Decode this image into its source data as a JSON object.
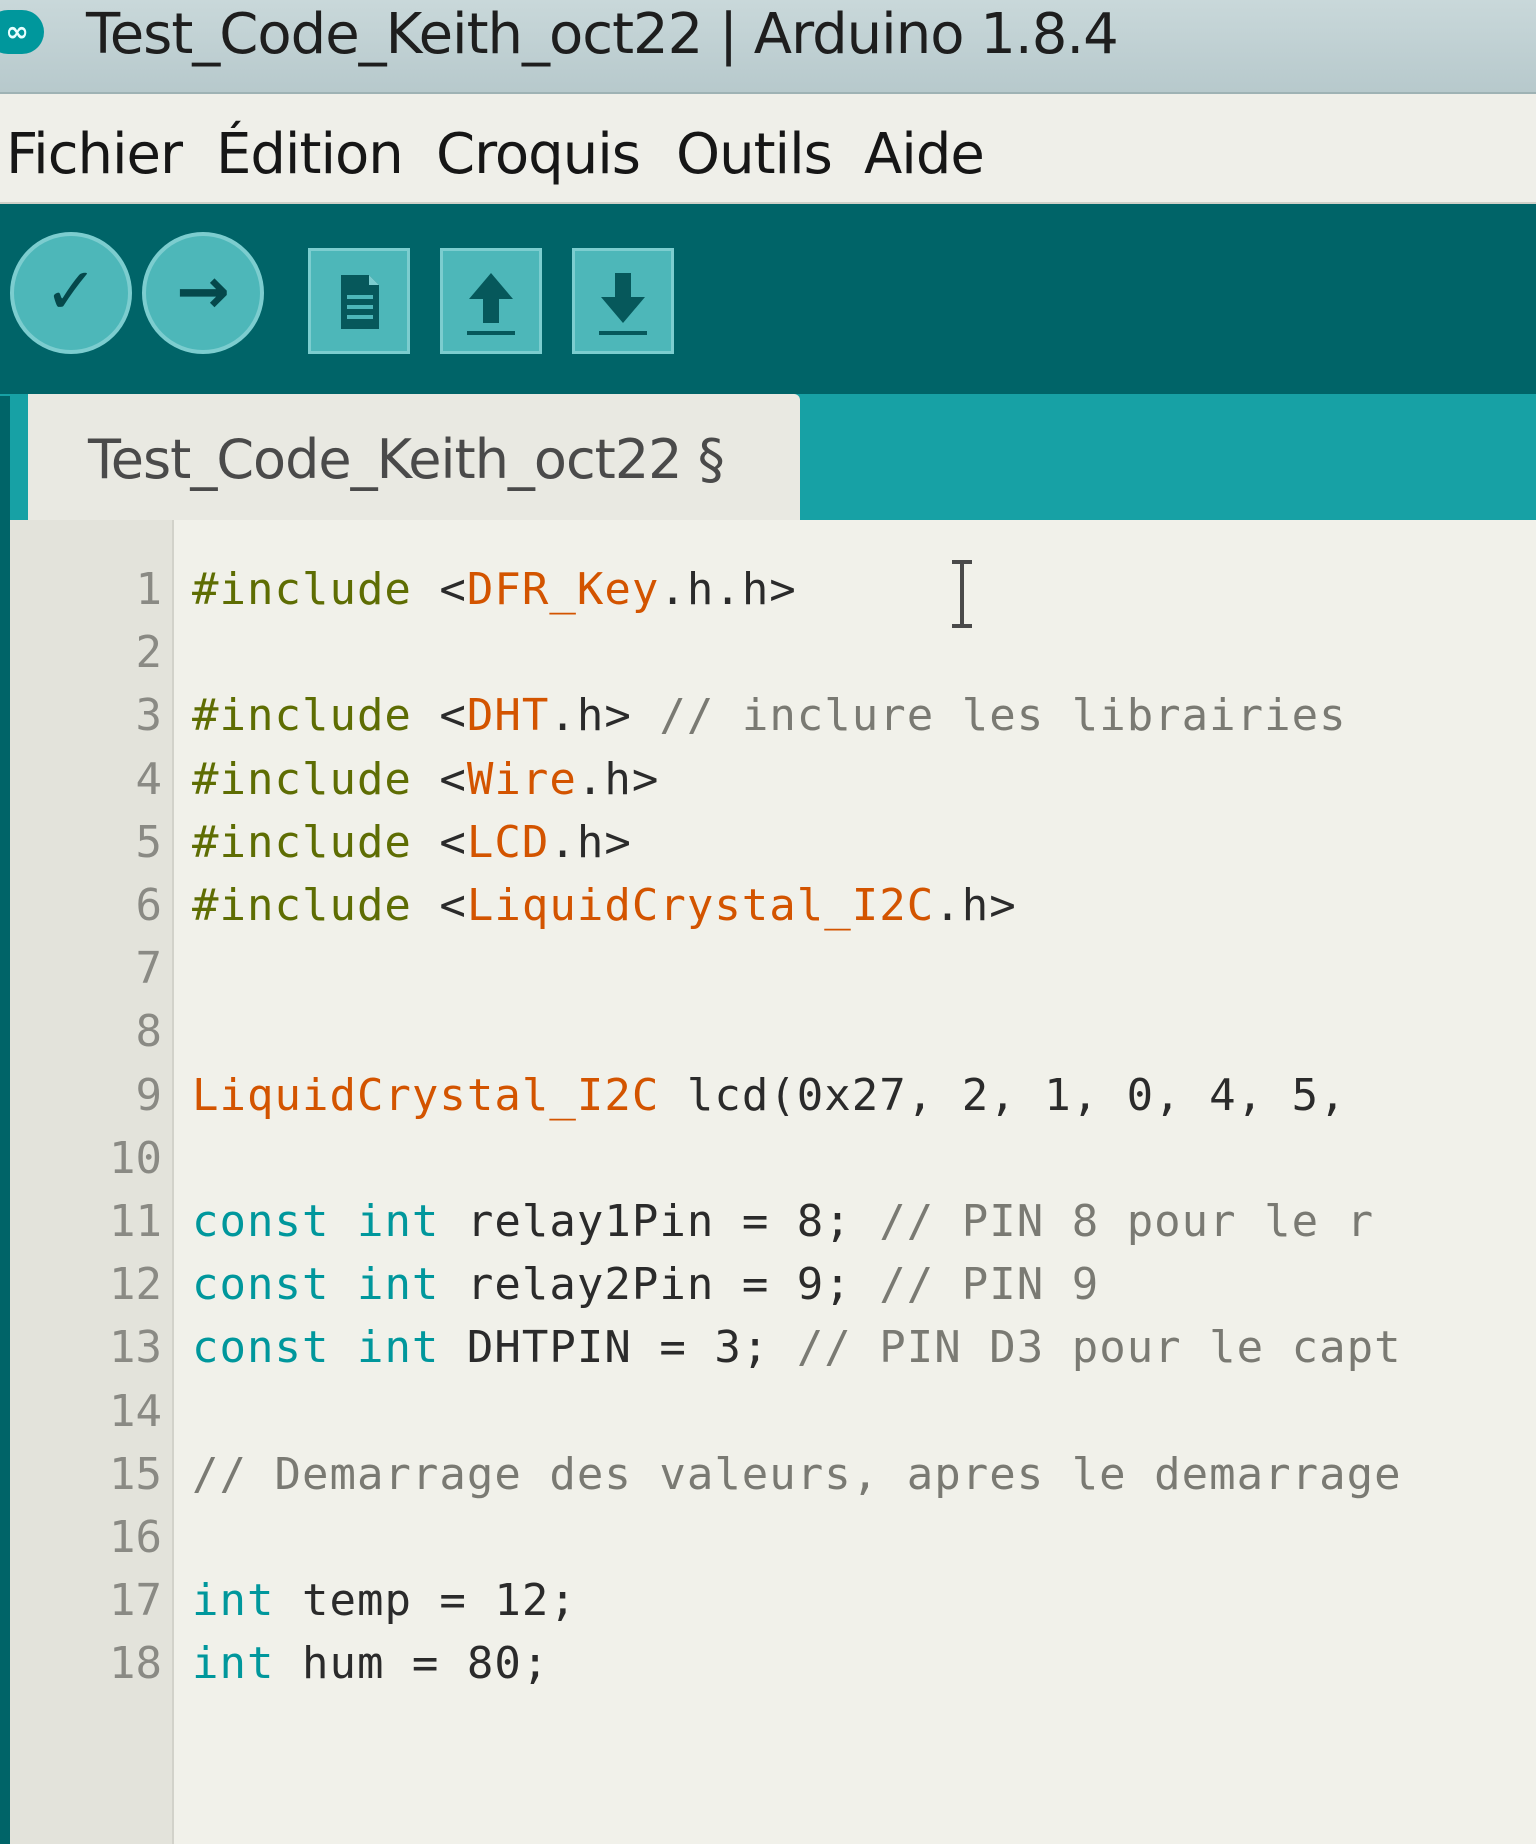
{
  "window": {
    "title": "Test_Code_Keith_oct22 | Arduino 1.8.4",
    "logo_glyph": "∞"
  },
  "menu": {
    "items": [
      "Fichier",
      "Édition",
      "Croquis",
      "Outils",
      "Aide"
    ]
  },
  "toolbar": {
    "buttons": [
      {
        "name": "verify-button",
        "icon": "check-icon",
        "glyph": "✓"
      },
      {
        "name": "upload-button",
        "icon": "arrow-right-icon",
        "glyph": "→"
      },
      {
        "name": "new-button",
        "icon": "document-icon"
      },
      {
        "name": "open-button",
        "icon": "arrow-up-icon"
      },
      {
        "name": "save-button",
        "icon": "arrow-down-icon"
      }
    ],
    "colors": {
      "bar": "#006468",
      "button": "#4db7b9"
    }
  },
  "tab": {
    "label": "Test_Code_Keith_oct22 §"
  },
  "editor": {
    "line_numbers": [
      "1",
      "2",
      "3",
      "4",
      "5",
      "6",
      "7",
      "8",
      "9",
      "10",
      "11",
      "12",
      "13",
      "14",
      "15",
      "16",
      "17",
      "18"
    ],
    "lines": [
      [
        {
          "t": "#include",
          "c": "directive"
        },
        {
          "t": " <",
          "c": "plain"
        },
        {
          "t": "DFR_Key",
          "c": "lib"
        },
        {
          "t": ".h.h>",
          "c": "plain"
        }
      ],
      [],
      [
        {
          "t": "#include",
          "c": "directive"
        },
        {
          "t": " <",
          "c": "plain"
        },
        {
          "t": "DHT",
          "c": "lib"
        },
        {
          "t": ".h> ",
          "c": "plain"
        },
        {
          "t": "// inclure les librairies",
          "c": "comment"
        }
      ],
      [
        {
          "t": "#include",
          "c": "directive"
        },
        {
          "t": " <",
          "c": "plain"
        },
        {
          "t": "Wire",
          "c": "lib"
        },
        {
          "t": ".h>",
          "c": "plain"
        }
      ],
      [
        {
          "t": "#include",
          "c": "directive"
        },
        {
          "t": " <",
          "c": "plain"
        },
        {
          "t": "LCD",
          "c": "lib"
        },
        {
          "t": ".h>",
          "c": "plain"
        }
      ],
      [
        {
          "t": "#include",
          "c": "directive"
        },
        {
          "t": " <",
          "c": "plain"
        },
        {
          "t": "LiquidCrystal_I2C",
          "c": "lib"
        },
        {
          "t": ".h>",
          "c": "plain"
        }
      ],
      [],
      [],
      [
        {
          "t": "LiquidCrystal_I2C",
          "c": "lib"
        },
        {
          "t": " lcd(0x27, 2, 1, 0, 4, 5,",
          "c": "plain"
        }
      ],
      [],
      [
        {
          "t": "const",
          "c": "type"
        },
        {
          "t": " ",
          "c": "plain"
        },
        {
          "t": "int",
          "c": "type"
        },
        {
          "t": " relay1Pin = 8; ",
          "c": "plain"
        },
        {
          "t": "// PIN 8 pour le r",
          "c": "comment"
        }
      ],
      [
        {
          "t": "const",
          "c": "type"
        },
        {
          "t": " ",
          "c": "plain"
        },
        {
          "t": "int",
          "c": "type"
        },
        {
          "t": " relay2Pin = 9; ",
          "c": "plain"
        },
        {
          "t": "// PIN 9",
          "c": "comment"
        }
      ],
      [
        {
          "t": "const",
          "c": "type"
        },
        {
          "t": " ",
          "c": "plain"
        },
        {
          "t": "int",
          "c": "type"
        },
        {
          "t": " DHTPIN = 3; ",
          "c": "plain"
        },
        {
          "t": "// PIN D3 pour le capt",
          "c": "comment"
        }
      ],
      [],
      [
        {
          "t": "// Demarrage des valeurs, apres le demarrage",
          "c": "comment"
        }
      ],
      [],
      [
        {
          "t": "int",
          "c": "type"
        },
        {
          "t": " temp = 12;",
          "c": "plain"
        }
      ],
      [
        {
          "t": "int",
          "c": "type"
        },
        {
          "t": " hum = 80;",
          "c": "plain"
        }
      ]
    ],
    "colors": {
      "directive": "#5e6d03",
      "lib": "#d35400",
      "type": "#00979c",
      "comment": "#7a7a73",
      "plain": "#2b2b2b"
    }
  }
}
